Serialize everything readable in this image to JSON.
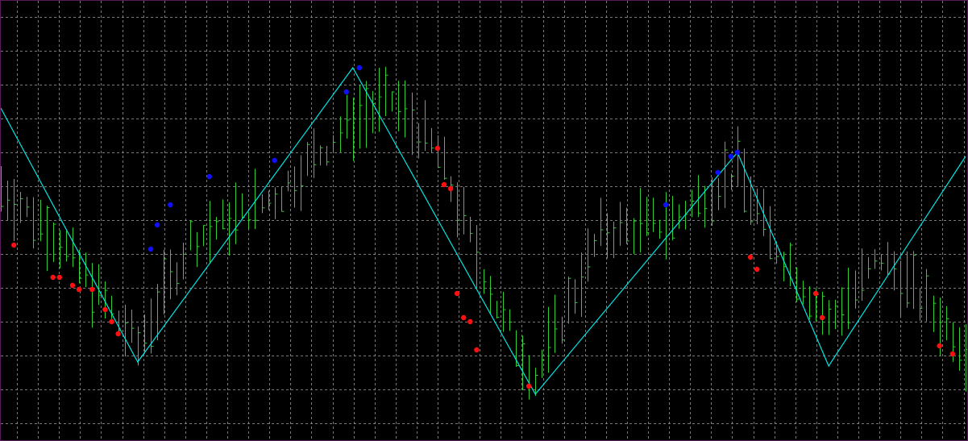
{
  "chart_data": {
    "type": "line",
    "title": "",
    "xlabel": "",
    "ylabel": "",
    "grid": true,
    "xlim": [
      0,
      148
    ],
    "ylim": [
      0,
      100
    ],
    "colors": {
      "background": "#000000",
      "grid": "#a0a0a0",
      "frame": "#5a1a5a",
      "bars": "#33cc33",
      "zigzag": "#00e5e5",
      "signal_high": "#1010ff",
      "signal_low": "#ff1010"
    },
    "series": [
      {
        "type": "zigzag",
        "x": [
          0,
          21,
          54,
          82,
          113,
          127,
          148
        ],
        "y": [
          77,
          14,
          87,
          6,
          66,
          13,
          65
        ]
      },
      {
        "type": "price_bars",
        "seed": 7,
        "anchors": {
          "x": [
            0,
            8,
            21,
            29,
            42,
            54,
            60,
            67,
            76,
            82,
            92,
            103,
            113,
            118,
            127,
            135,
            148
          ],
          "y": [
            57,
            46,
            18,
            44,
            55,
            74,
            79,
            66,
            28,
            10,
            46,
            49,
            62,
            45,
            24,
            40,
            18
          ]
        }
      },
      {
        "type": "signal_high",
        "x": [
          23,
          24,
          26,
          32,
          42,
          53,
          55,
          102,
          110,
          112,
          113
        ],
        "y": [
          42,
          48,
          53,
          60,
          64,
          81,
          87,
          53,
          61,
          65,
          66
        ]
      },
      {
        "type": "signal_low",
        "x": [
          2,
          8,
          9,
          11,
          12,
          14,
          16,
          17,
          18,
          67,
          68,
          69,
          70,
          71,
          72,
          73,
          81,
          115,
          116,
          125,
          126,
          144,
          146
        ],
        "y": [
          43,
          35,
          35,
          33,
          32,
          32,
          27,
          24,
          21,
          67,
          58,
          57,
          31,
          25,
          24,
          17,
          8,
          40,
          37,
          31,
          25,
          18,
          16
        ]
      }
    ]
  }
}
